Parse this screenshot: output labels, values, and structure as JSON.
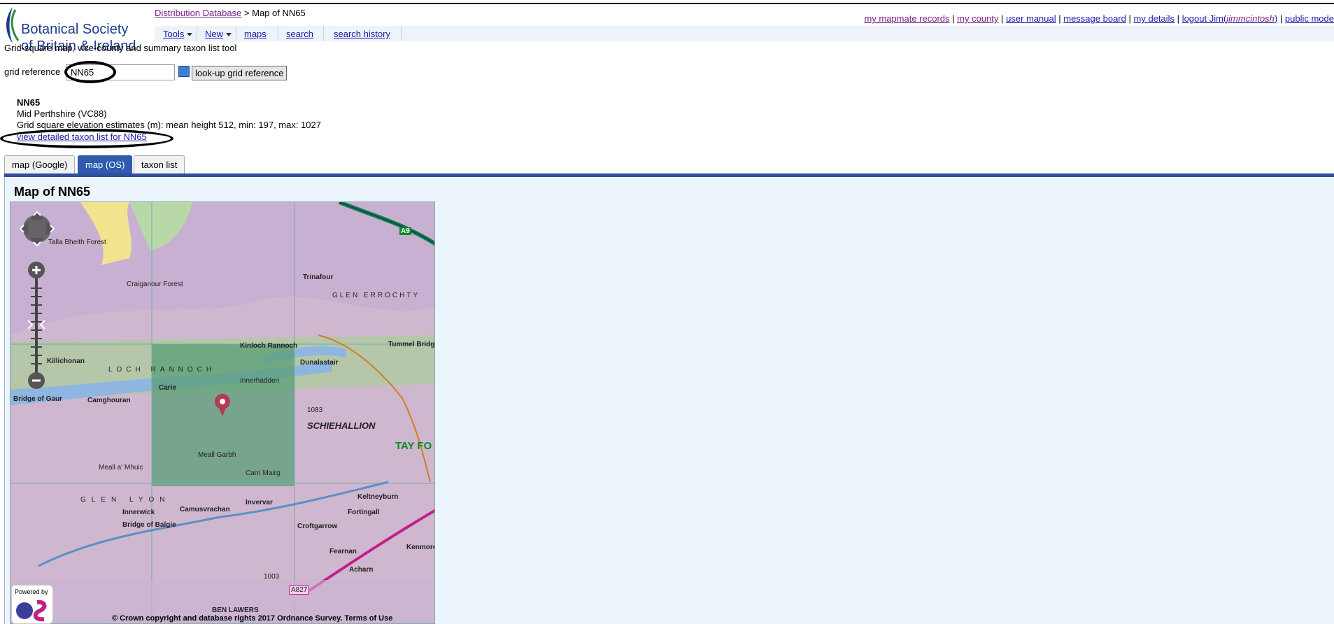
{
  "logo": {
    "line1": "Botanical Society",
    "line2": "of Britain & Ireland"
  },
  "breadcrumb": {
    "link": "Distribution Database",
    "separator": ">",
    "current": "Map of NN65"
  },
  "toolbar": {
    "tools": "Tools",
    "new": "New",
    "maps": "maps",
    "search": "search",
    "search_history": "search history"
  },
  "subtitle": "Grid-square map, vice-county and summary taxon list tool",
  "toplinks": {
    "mapmate": "my mapmate records",
    "county": "my county",
    "manual": "user manual",
    "board": "message board",
    "details": "my details",
    "logout": "logout Jim",
    "user": "jimmcintosh",
    "public": "public mode",
    "sep": "|"
  },
  "gridref": {
    "label": "grid reference",
    "value": "NN65",
    "lookup_label": "look-up grid reference"
  },
  "square": {
    "name": "NN65",
    "county": "Mid Perthshire (VC88)",
    "elevation": "Grid square elevation estimates (m): mean height 512, min: 197, max: 1027",
    "taxon_link": "view detailed taxon list for NN65"
  },
  "tabs": [
    {
      "label": "map (Google)",
      "active": false
    },
    {
      "label": "map (OS)",
      "active": true
    },
    {
      "label": "taxon list",
      "active": false
    }
  ],
  "map": {
    "title": "Map of NN65",
    "powered_by": "Powered by",
    "copyright": "© Crown copyright and database rights 2017 Ordnance Survey. Terms of Use",
    "labels": [
      "Talla Bheith Forest",
      "Craiganour Forest",
      "Kinloch Rannoch",
      "Killichonan",
      "Carie",
      "Camghouran",
      "Bridge of Gaur",
      "Innerhadden",
      "SCHIEHALLION",
      "TAY FO",
      "Dunalastair",
      "Tummel Bridge",
      "Meall a' Mhuic",
      "Camusvrachan",
      "Invervar",
      "Croftgarrow",
      "Fearnan",
      "Kenmore",
      "Acharn",
      "BEN LAWERS",
      "GLEN ERROCHTY",
      "Trinafour",
      "Bridge of Balgie",
      "Innerwick",
      "Keltneyburn",
      "Fortingall",
      "LOCH RANNOCH",
      "GLEN LYON",
      "A9",
      "A827",
      "Meall Garbh",
      "Carn Mairg",
      "1083",
      "1003"
    ]
  },
  "colors": {
    "tab_active": "#2f5aae",
    "panel_bg": "#ecf4fc",
    "link_purple": "#7a1f8a",
    "link_blue": "#1a1aa6",
    "logo_blue": "#1b3c8c"
  }
}
